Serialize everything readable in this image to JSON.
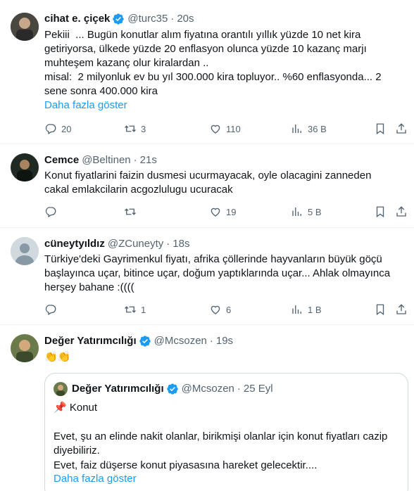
{
  "tweets": [
    {
      "name": "cihat e. çiçek",
      "handle": "@turc35",
      "time": "20s",
      "verified": true,
      "body": "Pekiii  ... Bugün konutlar alım fiyatına orantılı yıllık yüzde 10 net kira\ngetiriyorsa, ülkede yüzde 20 enflasyon olunca yüzde 10 kazanç marjı\nmuhteşem kazanç olur kiralardan ..\nmisal:  2 milyonluk ev bu yıl 300.000 kira topluyor.. %60 enflasyonda... 2\nsene sonra 400.000 kira",
      "show_more": "Daha fazla göster",
      "replies": "20",
      "retweets": "3",
      "likes": "110",
      "views": "36 B"
    },
    {
      "name": "Cemce",
      "handle": "@Beltinen",
      "time": "21s",
      "verified": false,
      "body": "Konut fiyatlarini faizin dusmesi ucurmayacak, oyle olacagini zanneden\ncakal emlakcilarin acgozlulugu ucuracak",
      "replies": "",
      "retweets": "",
      "likes": "19",
      "views": "5 B"
    },
    {
      "name": "cüneytyıldız",
      "handle": "@ZCuneyty",
      "time": "18s",
      "verified": false,
      "body": "Türkiye'deki Gayrimenkul fiyatı, afrika çöllerinde hayvanların büyük göçü\nbaşlayınca uçar, bitince uçar, doğum yaptıklarında uçar... Ahlak olmayınca\nherşey bahane :((((",
      "replies": "",
      "retweets": "1",
      "likes": "6",
      "views": "1 B"
    },
    {
      "name": "Değer Yatırımcılığı",
      "handle": "@Mcsozen",
      "time": "19s",
      "verified": true,
      "body": "👏👏"
    }
  ],
  "quote": {
    "name": "Değer Yatırımcılığı",
    "handle": "@Mcsozen",
    "date": "25 Eyl",
    "line1": "📌 Konut",
    "line2": "Evet, şu an elinde nakit olanlar, birikmişi olanlar için konut fiyatları cazip\ndiyebiliriz.",
    "line3": "Evet, faiz düşerse konut piyasasına hareket gelecektir....",
    "show_more": "Daha fazla göster"
  },
  "colors": {
    "accent": "#1d9bf0",
    "muted": "#536471",
    "text": "#0f1419",
    "border": "#eff3f4"
  }
}
